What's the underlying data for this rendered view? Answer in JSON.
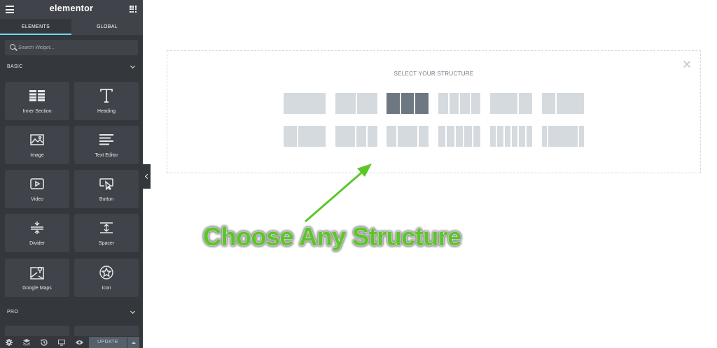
{
  "sidebar": {
    "logo": "elementor",
    "tabs": [
      {
        "label": "ELEMENTS"
      },
      {
        "label": "GLOBAL"
      }
    ],
    "search": {
      "placeholder": "Search Widget..."
    },
    "sections": {
      "basic": "BASIC",
      "pro": "PRO"
    },
    "widgets": [
      {
        "label": "Inner Section",
        "icon": "inner-section-icon"
      },
      {
        "label": "Heading",
        "icon": "heading-icon"
      },
      {
        "label": "Image",
        "icon": "image-icon"
      },
      {
        "label": "Text Editor",
        "icon": "text-editor-icon"
      },
      {
        "label": "Video",
        "icon": "video-icon"
      },
      {
        "label": "Button",
        "icon": "button-icon"
      },
      {
        "label": "Divider",
        "icon": "divider-icon"
      },
      {
        "label": "Spacer",
        "icon": "spacer-icon"
      },
      {
        "label": "Google Maps",
        "icon": "google-maps-icon"
      },
      {
        "label": "Icon",
        "icon": "star-icon"
      }
    ],
    "footer": {
      "update_label": "UPDATE"
    }
  },
  "canvas": {
    "title": "SELECT YOUR STRUCTURE",
    "selected_preset": 3
  },
  "annotation": {
    "caption": "Choose Any Structure",
    "color": "#5cc629"
  },
  "colors": {
    "sidebar": "#34383c",
    "accent": "#71d7f7",
    "preset": "#d5dadf",
    "preset_active": "#6d7882"
  }
}
